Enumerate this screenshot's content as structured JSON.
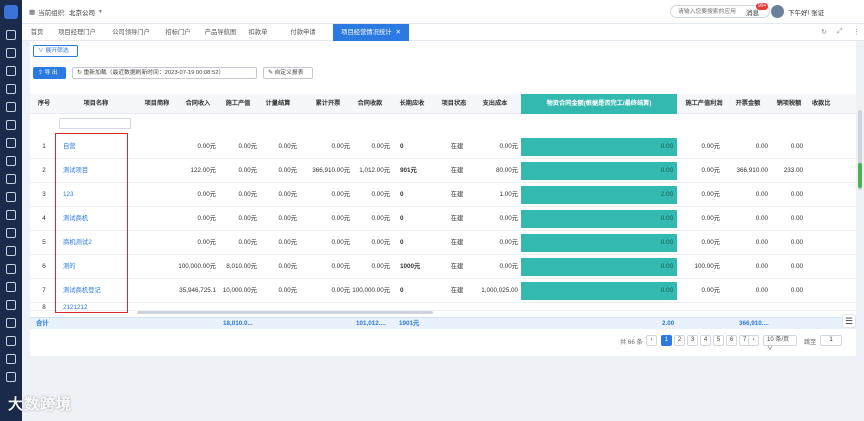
{
  "topbar": {
    "org_label": "当前组织:",
    "org_value": "北京公司",
    "search_placeholder": "请输入您要搜索的应用",
    "messages_label": "消息",
    "messages_badge": "99+",
    "greeting": "下午好! 张证"
  },
  "tabs": [
    "首页",
    "项目经理门户",
    "公司领导门户",
    "招标门户",
    "产品导航图",
    "扣款单",
    "付款申请",
    "项目经营情况统计"
  ],
  "active_tab": "项目经营情况统计",
  "toolbar": {
    "expand_filter": "展开筛选",
    "export": "导 出",
    "reload": "重新加载（最近数据刷新时间：2023-07-19 00:08:52）",
    "custom_report": "自定义报表"
  },
  "table": {
    "headers": [
      "序号",
      "项目名称",
      "项目简称",
      "合同收入",
      "施工产值",
      "计量结算",
      "累计开票",
      "合同收款",
      "长期应收",
      "项目状态",
      "支出成本",
      "物资合同金额(根据是否完工/最终结算)",
      "施工产值利润",
      "开票金额",
      "销项税额",
      "收款比"
    ],
    "rows": [
      {
        "no": "1",
        "name": "自营",
        "revenue": "0.00元",
        "output": "0.00元",
        "settle": "0.00元",
        "invoiced": "0.00元",
        "collected": "0.00元",
        "receivable": "0",
        "status": "在建",
        "cost": "0.00元",
        "material": "0.00",
        "profit": "0.00元",
        "invoice_amt": "0.00",
        "tax": "0.00"
      },
      {
        "no": "2",
        "name": "测试项目",
        "revenue": "122.00元",
        "output": "0.00元",
        "settle": "0.00元",
        "invoiced": "366,910.00元",
        "collected": "1,012.00元",
        "receivable": "901元",
        "status": "在建",
        "cost": "80.00元",
        "material": "0.00",
        "profit": "0.00元",
        "invoice_amt": "366,910.00",
        "tax": "233.00"
      },
      {
        "no": "3",
        "name": "123",
        "revenue": "0.00元",
        "output": "0.00元",
        "settle": "0.00元",
        "invoiced": "0.00元",
        "collected": "0.00元",
        "receivable": "0",
        "status": "在建",
        "cost": "1.00元",
        "material": "2.00",
        "profit": "0.00元",
        "invoice_amt": "0.00",
        "tax": "0.00"
      },
      {
        "no": "4",
        "name": "测试商机",
        "revenue": "0.00元",
        "output": "0.00元",
        "settle": "0.00元",
        "invoiced": "0.00元",
        "collected": "0.00元",
        "receivable": "0",
        "status": "在建",
        "cost": "0.00元",
        "material": "0.00",
        "profit": "0.00元",
        "invoice_amt": "0.00",
        "tax": "0.00"
      },
      {
        "no": "5",
        "name": "商机测试2",
        "revenue": "0.00元",
        "output": "0.00元",
        "settle": "0.00元",
        "invoiced": "0.00元",
        "collected": "0.00元",
        "receivable": "0",
        "status": "在建",
        "cost": "0.00元",
        "material": "0.00",
        "profit": "0.00元",
        "invoice_amt": "0.00",
        "tax": "0.00"
      },
      {
        "no": "6",
        "name": "测的",
        "revenue": "100,000.00元",
        "output": "8,010.00元",
        "settle": "0.00元",
        "invoiced": "0.00元",
        "collected": "0.00元",
        "receivable": "1000元",
        "status": "在建",
        "cost": "0.00元",
        "material": "0.00",
        "profit": "100.00元",
        "invoice_amt": "0.00",
        "tax": "0.00"
      },
      {
        "no": "7",
        "name": "测试商机登记",
        "revenue": "35,946,725.1",
        "output": "10,000.00元",
        "settle": "0.00元",
        "invoiced": "0.00元",
        "collected": "100,000.00元",
        "receivable": "0",
        "status": "在建",
        "cost": "1,000,025.00",
        "material": "0.00",
        "profit": "0.00元",
        "invoice_amt": "0.00",
        "tax": "0.00"
      }
    ],
    "partial_row": {
      "no": "8",
      "name": "2121212"
    },
    "footer": {
      "label": "合计",
      "output": "18,010.0...",
      "collected": "101,012....",
      "receivable": "1901元",
      "material": "2.00",
      "invoice_amt": "366,910...."
    }
  },
  "pagination": {
    "total": "共 66 条",
    "pages": [
      "1",
      "2",
      "3",
      "4",
      "5",
      "6",
      "7"
    ],
    "current": "1",
    "page_size": "10 条/页",
    "goto_label": "跳至",
    "goto_value": "1"
  },
  "watermark": "大数跨境"
}
